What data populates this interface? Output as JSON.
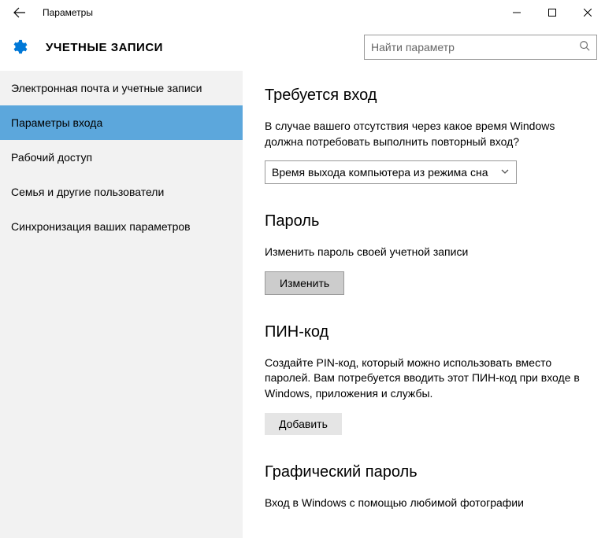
{
  "titlebar": {
    "title": "Параметры"
  },
  "header": {
    "section_title": "УЧЕТНЫЕ ЗАПИСИ",
    "search_placeholder": "Найти параметр"
  },
  "sidebar": {
    "items": [
      {
        "label": "Электронная почта и учетные записи"
      },
      {
        "label": "Параметры входа"
      },
      {
        "label": "Рабочий доступ"
      },
      {
        "label": "Семья и другие пользователи"
      },
      {
        "label": "Синхронизация ваших параметров"
      }
    ]
  },
  "main": {
    "sign_in": {
      "heading": "Требуется вход",
      "desc": "В случае вашего отсутствия через какое время Windows должна потребовать выполнить повторный вход?",
      "dropdown_value": "Время выхода компьютера из режима сна"
    },
    "password": {
      "heading": "Пароль",
      "desc": "Изменить пароль своей учетной записи",
      "button": "Изменить"
    },
    "pin": {
      "heading": "ПИН-код",
      "desc": "Создайте PIN-код, который можно использовать вместо паролей. Вам потребуется вводить этот ПИН-код при входе в Windows, приложения и службы.",
      "button": "Добавить"
    },
    "picture": {
      "heading": "Графический пароль",
      "desc": "Вход в Windows с помощью любимой фотографии"
    }
  }
}
